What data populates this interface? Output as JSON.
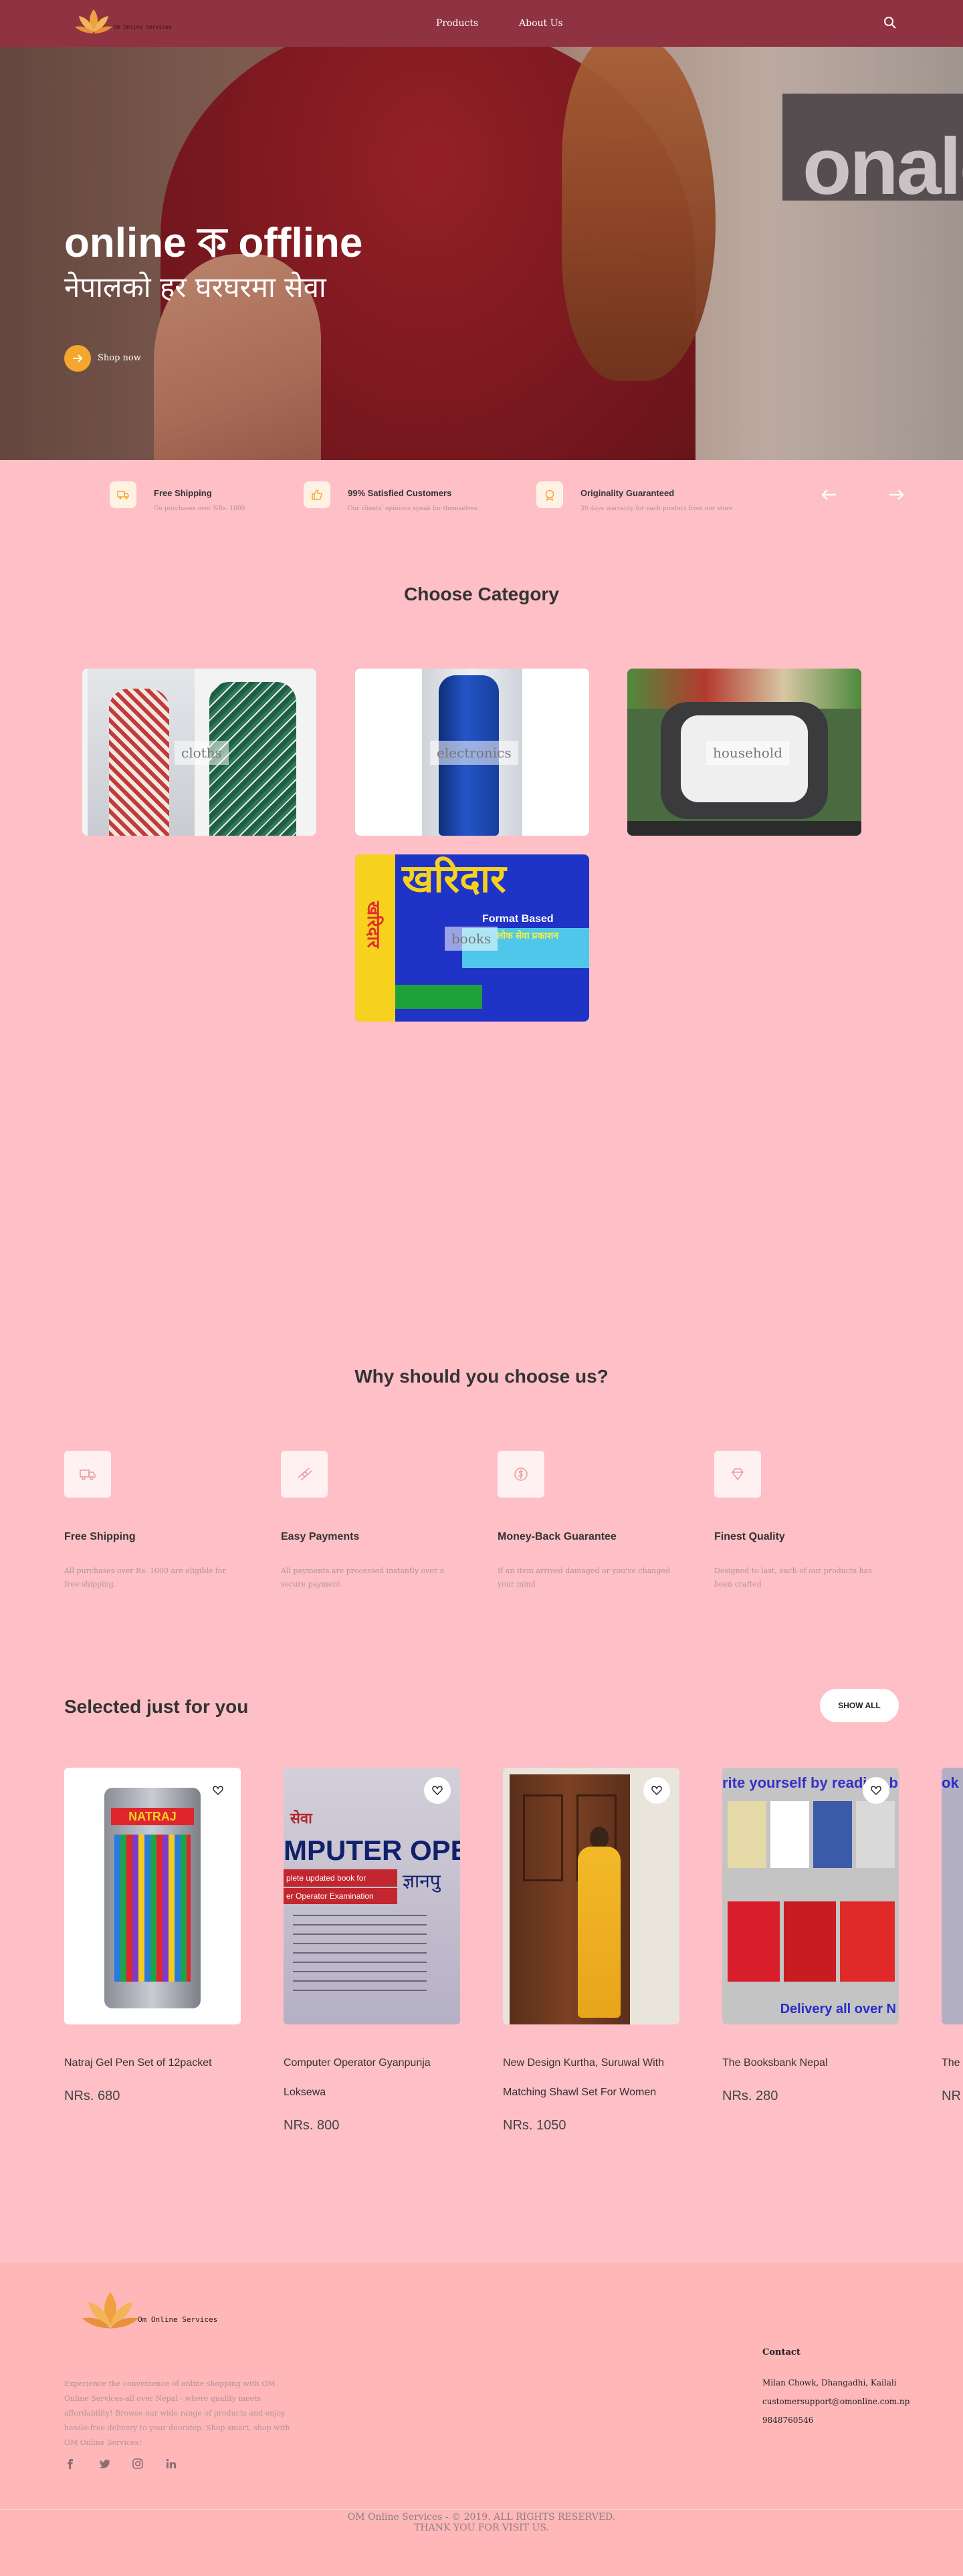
{
  "nav": {
    "logo_text": "Om Online Services",
    "links": [
      "Products",
      "About Us"
    ]
  },
  "hero": {
    "title": "online ক offline",
    "subtitle": "नेपालको हर घरघरमा सेवा",
    "shop_label": "Shop now",
    "sign_text": "onald"
  },
  "features": [
    {
      "title": "Free Shipping",
      "text": "On purchases over NRs. 1000",
      "icon": "truck-icon"
    },
    {
      "title": "99% Satisfied Customers",
      "text": "Our clients' opinions speak for themselves",
      "icon": "thumbs-up-icon"
    },
    {
      "title": "Originality Guaranteed",
      "text": "30 days warranty for each product from our store",
      "icon": "badge-icon"
    }
  ],
  "category": {
    "title": "Choose Category",
    "items": [
      {
        "label": "cloths",
        "image": "kurta-sets"
      },
      {
        "label": "electronics",
        "image": "blue-bottle"
      },
      {
        "label": "household",
        "image": "vegetable-tray"
      },
      {
        "label": "books",
        "image": "kharidar-book",
        "book_title": "खरिदार",
        "book_side": "खरिदार",
        "book_tag": "Format Based",
        "book_sub": "लोक सेवा प्रकाशन"
      }
    ]
  },
  "why": {
    "title": "Why should you choose us?",
    "items": [
      {
        "title": "Free Shipping",
        "text": "All purchases over Rs. 1000 are eligible for free shipping.",
        "icon": "truck-icon"
      },
      {
        "title": "Easy Payments",
        "text": "All payments are processed instantly over a secure payment",
        "icon": "money-icon"
      },
      {
        "title": "Money-Back Guarantee",
        "text": "If an item arrived damaged or you've changed your mind",
        "icon": "dollar-icon"
      },
      {
        "title": "Finest Quality",
        "text": "Designed to last, each of our products has been crafted",
        "icon": "diamond-icon"
      }
    ]
  },
  "selected": {
    "title": "Selected just for you",
    "show_all": "SHOW ALL",
    "products": [
      {
        "name": "Natraj Gel Pen Set of 12packet",
        "price": "NRs. 680",
        "image": "pen-packet",
        "pack_label": "NATRAJ"
      },
      {
        "name": "Computer Operator Gyanpunja Loksewa",
        "price": "NRs. 800",
        "image": "computer-operator-book",
        "cover_top": "सेवा",
        "cover_title": "MPUTER OPERATO",
        "cover_mid": "plete updated book for",
        "cover_sub": "er Operator Examination",
        "cover_brand": "ज्ञानपु"
      },
      {
        "name": "New Design Kurtha, Suruwal With Matching Shawl Set For Women",
        "price": "NRs. 1050",
        "image": "yellow-kurtha"
      },
      {
        "name": "The Booksbank Nepal",
        "price": "NRs. 280",
        "image": "book-bundle",
        "banner_top": "rite yourself by reading b",
        "banner_bottom": "Delivery all over N"
      },
      {
        "name": "The",
        "price": "NR",
        "image": "partial-product",
        "banner": "ok"
      }
    ]
  },
  "footer": {
    "logo_text": "Om Online Services",
    "description": "Experience the convenience of online shopping with OM Online Services-all over Nepal - where quality meets affordability! Browse our wide range of products and enjoy hassle-free delivery to your doorstep. Shop smart, shop with OM Online Services!",
    "social": [
      "facebook-icon",
      "twitter-icon",
      "instagram-icon",
      "linkedin-icon"
    ],
    "contact_title": "Contact",
    "address": "Milan Chowk, Dhangadhi, Kailali",
    "email": "customersupport@omonline.com.np",
    "phone": "9848760546",
    "copyright": "OM Online Services - © 2019. ALL RIGHTS RESERVED.",
    "thanks": "THANK YOU FOR VISIT US."
  },
  "colors": {
    "nav": "#8f3242",
    "page": "#ffbfc6",
    "accent": "#f4a72d",
    "footer": "#ffb7b8"
  }
}
